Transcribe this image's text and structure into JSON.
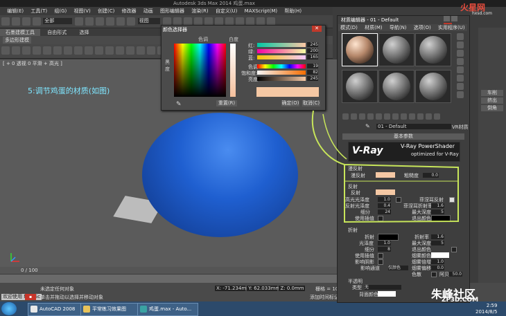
{
  "window": {
    "title": "Autodesk 3ds Max  2014    鸡蛋.max"
  },
  "menubar": {
    "items": [
      "编辑(E)",
      "工具(T)",
      "组(G)",
      "视图(V)",
      "创建(C)",
      "修改器",
      "动画",
      "图形编辑器",
      "渲染(R)",
      "自定义(U)",
      "MAXScript(M)",
      "帮助(H)"
    ]
  },
  "toolbar": {
    "selection_filter": "全部",
    "view_dropdown": "视图"
  },
  "ribbon": {
    "tabs": [
      "石墨建模工具",
      "自由形式",
      "选择"
    ],
    "panel_label": "多边形建模"
  },
  "viewport": {
    "label": "[ + 0 透视 0 平滑 + 高光 ]",
    "annotation": "5:调节鸡蛋的材质(如图)"
  },
  "timeline": {
    "frame_label": "0 / 100"
  },
  "status": {
    "welcome": "欢迎使用 MAXSc",
    "line1": "未选定任何对象",
    "line2": "单击并拖动以选择并移动对象",
    "x_value": "X: -71.234mm",
    "y_value": "Y: 62.033mm",
    "z_value": "Z: 0.0mm",
    "grid": "栅格 = 10.0mm",
    "add_time_tag": "添加时间标记"
  },
  "taskbar": {
    "items": [
      "AutoCAD 2008",
      "平常练习效果图",
      "鸡蛋.max - Auto..."
    ],
    "time": "2:59",
    "date": "2014/8/5"
  },
  "command_panel": {
    "buttons": [
      "车削",
      "挤出",
      "倒角"
    ]
  },
  "color_picker": {
    "title": "颜色选择器",
    "hue_label": "色调",
    "whiteness_label": "白度",
    "blackness_label": "黑度",
    "channels": [
      {
        "label": "红:",
        "value": "245"
      },
      {
        "label": "绿:",
        "value": "200"
      },
      {
        "label": "蓝:",
        "value": "165"
      },
      {
        "label": "色调:",
        "value": "19"
      },
      {
        "label": "饱和度:",
        "value": "82"
      },
      {
        "label": "亮度:",
        "value": "245"
      }
    ],
    "current_color": "#f5c8a4",
    "reset_label": "重置(R)",
    "ok_label": "确定(O)",
    "cancel_label": "取消(C)"
  },
  "material_editor": {
    "title": "材质编辑器 - 01 - Default",
    "menu": [
      "模式(D)",
      "材质(M)",
      "导航(N)",
      "选项(O)",
      "实用程序(U)"
    ],
    "material_name": "01 - Default",
    "material_type": "VR材质",
    "basic_params_label": "基本参数",
    "logo_text": "V-Ray",
    "logo_title": "V-Ray PowerShader",
    "logo_subtitle": "optimized for V-Ray",
    "diffuse": {
      "section": "漫反射",
      "diffuse_label": "漫反射",
      "roughness_label": "粗糙度",
      "roughness_value": "0.0",
      "diffuse_color": "#f5c8a4"
    },
    "reflection": {
      "section": "反射",
      "reflect_label": "反射",
      "hilight_gloss_label": "高光光泽度",
      "hilight_gloss_value": "1.0",
      "refl_gloss_label": "反射光泽度",
      "refl_gloss_value": "0.4",
      "subdivs_label": "细分",
      "subdivs_value": "24",
      "use_interp_label": "使用插值",
      "fresnel_label": "菲涅耳反射",
      "fresnel_ior_label": "菲涅耳折射率",
      "fresnel_ior_value": "1.6",
      "max_depth_label": "最大深度",
      "max_depth_value": "5",
      "exit_color_label": "退出颜色",
      "reflect_color": "#f5c8a4",
      "exit_color": "#000000"
    },
    "refraction": {
      "section": "折射",
      "refract_label": "折射",
      "ior_label": "折射率",
      "ior_value": "1.6",
      "glossiness_label": "光泽度",
      "glossiness_value": "1.0",
      "max_depth_label": "最大深度",
      "max_depth_value": "5",
      "subdivs_label": "细分",
      "subdivs_value": "8",
      "exit_color_label": "退出颜色",
      "use_interp_label": "使用插值",
      "fog_color_label": "烟雾颜色",
      "affect_shadows_label": "影响阴影",
      "fog_multiplier_label": "烟雾倍增",
      "fog_multiplier_value": "1.0",
      "affect_channels_label": "影响通道",
      "affect_channels_value": "仅颜色",
      "fog_bias_label": "烟雾偏移",
      "fog_bias_value": "0.0",
      "dispersion_label": "色散",
      "abbe_label": "阿贝",
      "abbe_value": "50.0"
    },
    "translucency": {
      "section": "半透明",
      "type_label": "类型",
      "type_value": "无",
      "back_color_label": "背面颜色"
    }
  },
  "watermarks": {
    "top": "火星网",
    "top_sub": "hxsd.com",
    "bottom": "朱峰社区",
    "bottom_sub": "ZF3D.COM"
  },
  "colors": {
    "egg_blue": "#1f5fd0",
    "callout_green": "#c8e65a",
    "accent_peach": "#f5c8a4"
  }
}
